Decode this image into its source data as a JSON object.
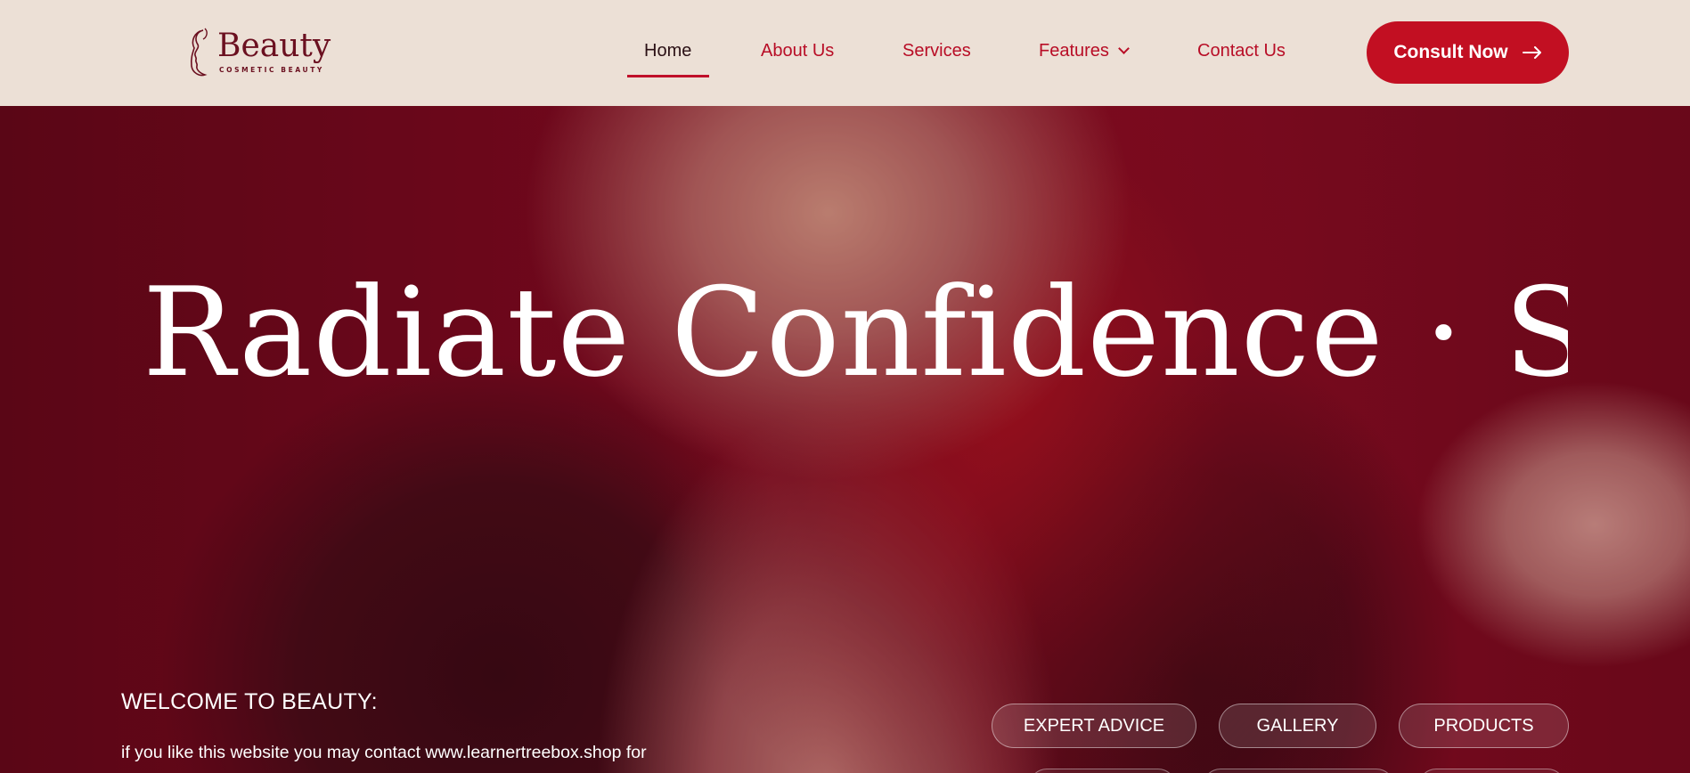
{
  "brand": {
    "logo_word": "Beauty",
    "logo_sub": "COSMETIC BEAUTY"
  },
  "nav": {
    "items": [
      {
        "label": "Home",
        "active": true
      },
      {
        "label": "About Us"
      },
      {
        "label": "Services"
      },
      {
        "label": "Features",
        "has_dropdown": true
      },
      {
        "label": "Contact Us"
      }
    ],
    "cta_label": "Consult Now"
  },
  "hero": {
    "marquee_text": "Radiate Confidence · Sh",
    "welcome_title": "WELCOME TO BEAUTY:",
    "welcome_body": "if you like this website you may contact www.learnertreebox.shop for",
    "pills": [
      "EXPERT ADVICE",
      "GALLERY",
      "PRODUCTS"
    ]
  },
  "colors": {
    "header_bg": "#ece0d6",
    "brand_red": "#c20f22",
    "nav_text": "#b80d26",
    "logo_color": "#6b1020"
  }
}
